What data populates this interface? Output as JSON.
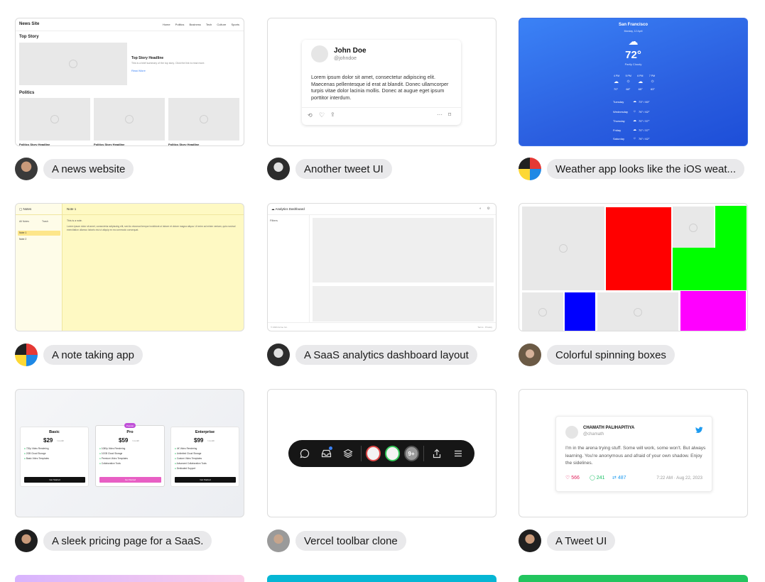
{
  "cards": [
    {
      "caption": "A news website"
    },
    {
      "caption": "Another tweet UI"
    },
    {
      "caption": "Weather app looks like the iOS weat..."
    },
    {
      "caption": "A note taking app"
    },
    {
      "caption": "A SaaS analytics dashboard layout"
    },
    {
      "caption": "Colorful spinning boxes"
    },
    {
      "caption": "A sleek pricing page for a SaaS."
    },
    {
      "caption": "Vercel toolbar clone"
    },
    {
      "caption": "A Tweet UI"
    }
  ],
  "news": {
    "brand": "News Site",
    "nav": [
      "Home",
      "Politics",
      "Business",
      "Tech",
      "Culture",
      "Sports"
    ],
    "top_story": "Top Story",
    "headline": "Top Story Headline",
    "summary": "This is a brief summary of the top story. Click the link to read more.",
    "read_more": "Read More",
    "politics": "Politics",
    "politics_headline": "Politics Story Headline"
  },
  "tweet1": {
    "name": "John Doe",
    "handle": "@johndoe",
    "body": "Lorem ipsum dolor sit amet, consectetur adipiscing elit. Maecenas pellentesque id erat at blandit. Donec ullamcorper turpis vitae dolor lacinia mollis. Donec at augue eget ipsum porttitor interdum."
  },
  "weather": {
    "city": "San Francisco",
    "date": "Monday, 12 April",
    "temp": "72°",
    "condition": "Partly Cloudy",
    "hours": [
      "4 PM",
      "5 PM",
      "6 PM",
      "7 PM"
    ],
    "hour_temps": [
      "70°",
      "68°",
      "65°",
      "63°"
    ],
    "days": [
      {
        "day": "Tuesday",
        "range": "73° / 60°"
      },
      {
        "day": "Wednesday",
        "range": "76° / 62°"
      },
      {
        "day": "Thursday",
        "range": "70° / 57°"
      },
      {
        "day": "Friday",
        "range": "70° / 57°"
      },
      {
        "day": "Saturday",
        "range": "76° / 62°"
      }
    ]
  },
  "notes": {
    "title": "Notes",
    "all_notes": "All Notes",
    "trash": "Trash",
    "items": [
      "Note 1",
      "Note 2"
    ],
    "editor_title": "Note 1",
    "editor_line1": "This is a note.",
    "editor_body": "Lorem ipsum dolor sit amet, consectetur adipiscing elit, sed do eiusmod tempor incididunt ut labore et dolore magna aliqua. Ut enim ad minim veniam, quis nostrud exercitation ullamco laboris nisi ut aliquip ex ea commodo consequat."
  },
  "dashboard": {
    "title": "Analytics Dashboard",
    "filters": "Filters",
    "footer_left": "© 2023 Acme Inc.",
    "footer_right": "Terms · Privacy"
  },
  "pricing": {
    "plans": [
      {
        "name": "Basic",
        "price": "$29",
        "per": "/ month",
        "features": [
          "720p Video Rendering",
          "2GB Cloud Storage",
          "Basic Video Templates"
        ],
        "cta": "Get Started"
      },
      {
        "name": "Pro",
        "price": "$59",
        "per": "/ month",
        "badge": "Popular",
        "features": [
          "1080p Video Rendering",
          "10GB Cloud Storage",
          "Premium Video Templates",
          "Collaboration Tools"
        ],
        "cta": "Get Started"
      },
      {
        "name": "Enterprise",
        "price": "$99",
        "per": "/ month",
        "features": [
          "4K Video Rendering",
          "Unlimited Cloud Storage",
          "Custom Video Templates",
          "Advanced Collaboration Tools",
          "Dedicated Support"
        ],
        "cta": "Get Started"
      }
    ]
  },
  "toolbar": {
    "badge": "9+",
    "icons": [
      "comment-icon",
      "inbox-icon",
      "layers-icon",
      "share-icon",
      "menu-icon"
    ]
  },
  "tweet2": {
    "name": "CHAMATH PALIHAPITIYA",
    "handle": "@chamath",
    "body": "I'm in the arena trying stuff. Some will work, some won't. But always learning. You're anonymous and afraid of your own shadow. Enjoy the sidelines.",
    "likes": "566",
    "replies": "241",
    "retweets": "487",
    "timestamp": "7:22 AM · Aug 22, 2023"
  },
  "colors": {
    "red": "#ff0000",
    "green": "#00ff00",
    "blue": "#0000ff",
    "magenta": "#ff00ff",
    "pro_accent": "#e85fc4",
    "twitter_blue": "#1d9bf0"
  }
}
